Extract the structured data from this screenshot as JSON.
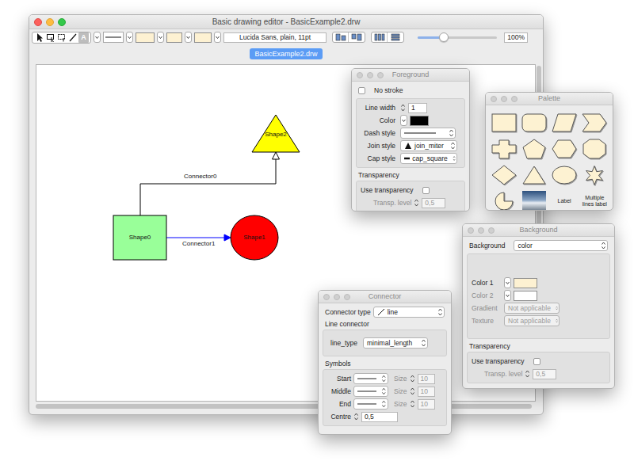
{
  "window": {
    "title": "Basic drawing editor - BasicExample2.drw"
  },
  "toolbar": {
    "text_tool": "A",
    "font": "Lucida Sans, plain, 11pt",
    "zoom": {
      "level": 0.33,
      "reading": "100%"
    }
  },
  "tabs": [
    {
      "label": "BasicExample2.drw",
      "selected": true
    }
  ],
  "diagram": {
    "shapes": [
      {
        "label": "Shape0",
        "kind": "rectangle",
        "color": "#99ff99"
      },
      {
        "label": "Shape1",
        "kind": "circle",
        "color": "#ff0000"
      },
      {
        "label": "Shape2",
        "kind": "triangle",
        "color": "#ffff00"
      }
    ],
    "connectors": [
      {
        "label": "Connector0",
        "color": "#000000"
      },
      {
        "label": "Connector1",
        "color": "#0000ff"
      }
    ]
  },
  "foreground": {
    "title": "Foreground",
    "no_stroke": {
      "label": "No stroke",
      "checked": false
    },
    "line_width": {
      "label": "Line width",
      "value": "1"
    },
    "color": {
      "label": "Color"
    },
    "dash_style": {
      "label": "Dash style"
    },
    "join_style": {
      "label": "Join style",
      "value": "join_miter"
    },
    "cap_style": {
      "label": "Cap style",
      "value": "cap_square"
    },
    "transparency": {
      "heading": "Transparency",
      "use": {
        "label": "Use transparency",
        "checked": false
      },
      "level": {
        "label": "Transp. level",
        "value": "0,5",
        "disabled": true
      }
    }
  },
  "palette": {
    "title": "Palette",
    "items": [
      {
        "kind": "rectangle"
      },
      {
        "kind": "rounded"
      },
      {
        "kind": "parallelogram"
      },
      {
        "kind": "chevron"
      },
      {
        "kind": "cross"
      },
      {
        "kind": "pentagon"
      },
      {
        "kind": "hexagon"
      },
      {
        "kind": "octagon"
      },
      {
        "kind": "diamond"
      },
      {
        "kind": "triangle"
      },
      {
        "kind": "ellipse"
      },
      {
        "kind": "star"
      },
      {
        "kind": "pie"
      },
      {
        "kind": "image"
      },
      {
        "kind": "text",
        "label": "Label"
      },
      {
        "kind": "text",
        "label": "Multiple lines label"
      }
    ]
  },
  "background": {
    "title": "Background",
    "type": {
      "label": "Background",
      "value": "color"
    },
    "colors": [
      {
        "label": "Color 1",
        "color": "#fdf1d2",
        "disabled": false
      },
      {
        "label": "Color 2",
        "color": "#ffffff",
        "disabled": true
      }
    ],
    "gradient": {
      "label": "Gradient",
      "value": "Not applicable",
      "disabled": true
    },
    "texture": {
      "label": "Texture",
      "value": "Not applicable",
      "disabled": true
    },
    "transparency": {
      "heading": "Transparency",
      "use": {
        "label": "Use transparency",
        "checked": false
      },
      "level": {
        "label": "Transp. level",
        "value": "0,5",
        "disabled": true
      }
    }
  },
  "connector": {
    "title": "Connector",
    "type": {
      "label": "Connector type",
      "value": "line"
    },
    "line_connector": {
      "heading": "Line connector",
      "label": "line_type",
      "value": "minimal_length"
    },
    "symbols": {
      "heading": "Symbols",
      "rows": [
        {
          "label": "Start",
          "size_label": "Size",
          "size": "10",
          "size_disabled": true
        },
        {
          "label": "Middle",
          "size_label": "Size",
          "size": "10",
          "size_disabled": true
        },
        {
          "label": "End",
          "size_label": "Size",
          "size": "10",
          "size_disabled": true
        }
      ]
    },
    "centre": {
      "label": "Centre",
      "value": "0,5"
    }
  }
}
